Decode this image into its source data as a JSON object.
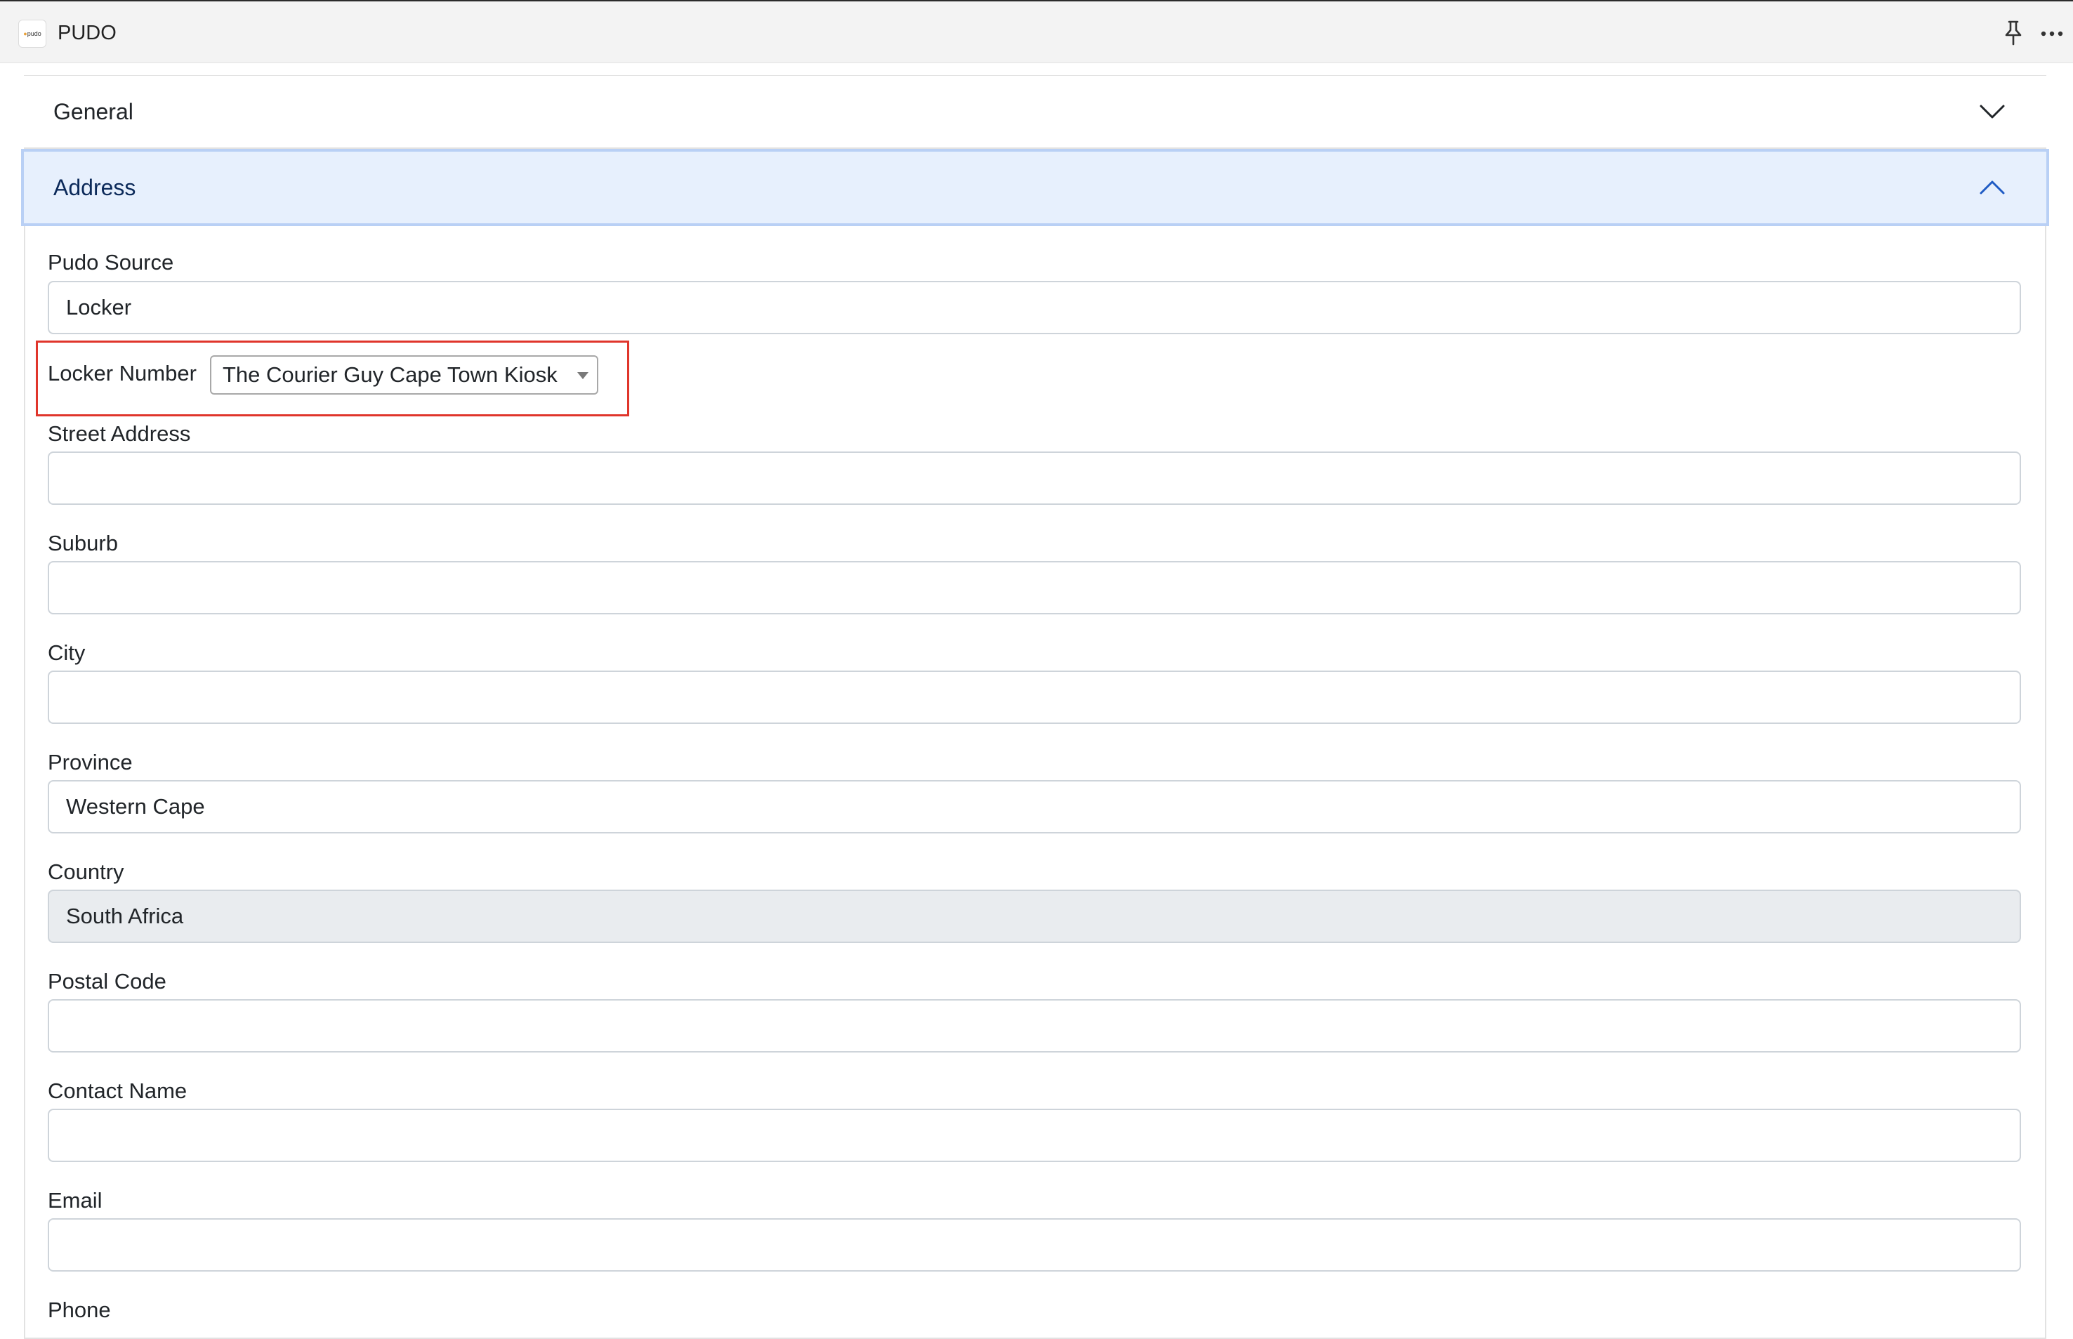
{
  "window": {
    "title": "PUDO",
    "logo_text": "pudo",
    "icons": [
      "pin-icon",
      "more-icon"
    ]
  },
  "accordion": {
    "general_label": "General",
    "address_label": "Address"
  },
  "fields": {
    "pudo_source": {
      "label": "Pudo Source",
      "value": "Locker"
    },
    "locker_number": {
      "label": "Locker Number",
      "selected": "The Courier Guy Cape Town Kiosk"
    },
    "street_address": {
      "label": "Street Address",
      "value": ""
    },
    "suburb": {
      "label": "Suburb",
      "value": ""
    },
    "city": {
      "label": "City",
      "value": ""
    },
    "province": {
      "label": "Province",
      "value": "Western Cape"
    },
    "country": {
      "label": "Country",
      "value": "South Africa"
    },
    "postal_code": {
      "label": "Postal Code",
      "value": ""
    },
    "contact_name": {
      "label": "Contact Name",
      "value": ""
    },
    "email": {
      "label": "Email",
      "value": ""
    },
    "phone": {
      "label": "Phone"
    }
  },
  "colors": {
    "highlight_border": "#e0352b",
    "active_header_bg": "#e7f0fd",
    "active_header_border": "#b9d0f5"
  }
}
